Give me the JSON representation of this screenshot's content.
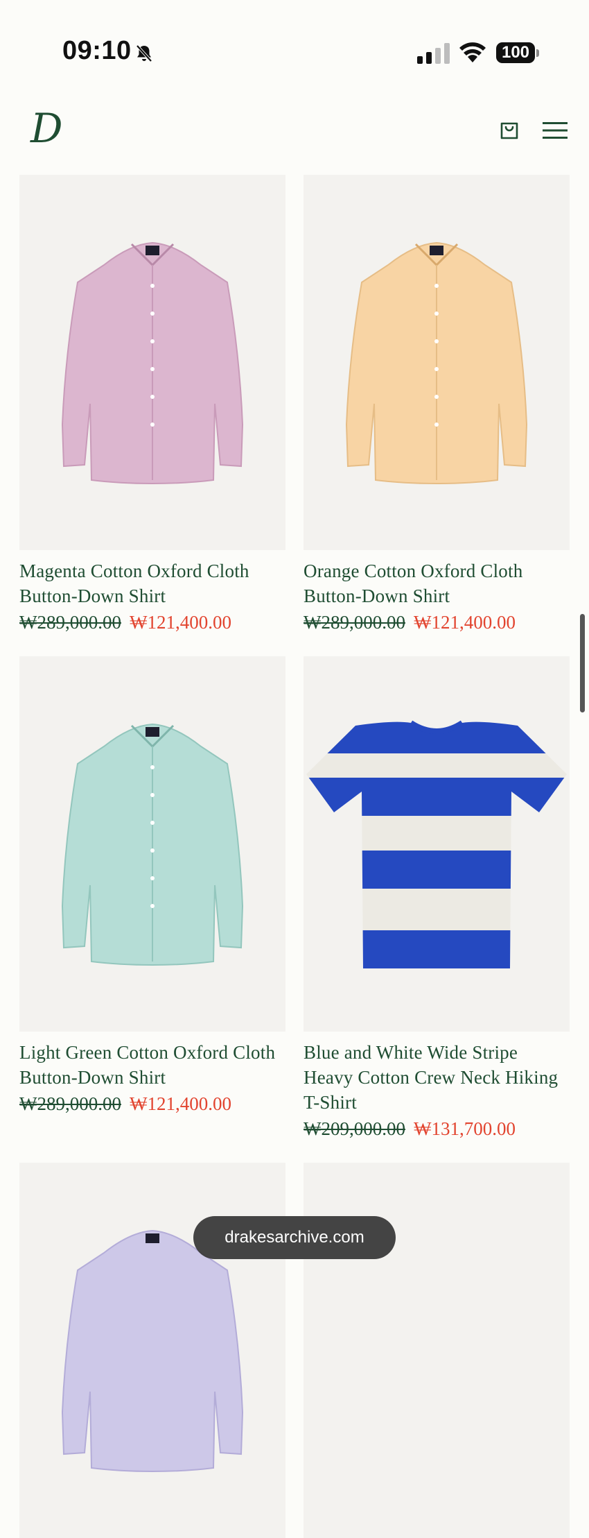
{
  "status_bar": {
    "time": "09:10",
    "battery": "100"
  },
  "site": {
    "logo": "D",
    "url": "drakesarchive.com"
  },
  "products": [
    {
      "name": "Magenta Cotton Oxford Cloth Button-Down Shirt",
      "original_price": "₩289,000.00",
      "sale_price": "₩121,400.00",
      "color": "#dcb6cf"
    },
    {
      "name": "Orange Cotton Oxford Cloth Button-Down Shirt",
      "original_price": "₩289,000.00",
      "sale_price": "₩121,400.00",
      "color": "#f8d4a4"
    },
    {
      "name": "Light Green Cotton Oxford Cloth Button-Down Shirt",
      "original_price": "₩289,000.00",
      "sale_price": "₩121,400.00",
      "color": "#b5ddd6"
    },
    {
      "name": "Blue and White Wide Stripe Heavy Cotton Crew Neck Hiking T-Shirt",
      "original_price": "₩209,000.00",
      "sale_price": "₩131,700.00",
      "color": "#2549c0"
    }
  ],
  "colors": {
    "brand_green": "#1f4d32",
    "sale_red": "#e2442f",
    "image_bg": "#f3f2ef"
  }
}
